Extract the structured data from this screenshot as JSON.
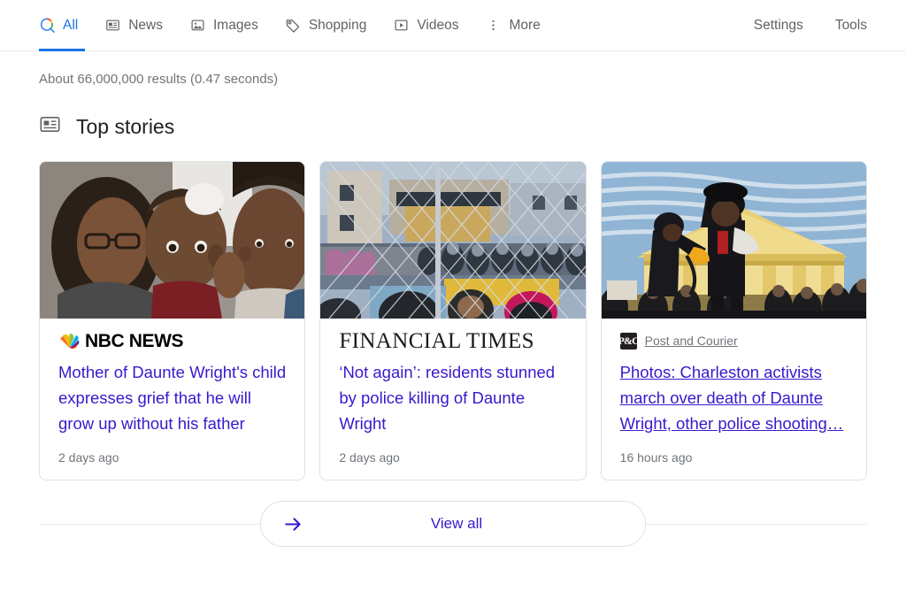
{
  "nav": {
    "tabs": [
      {
        "label": "All",
        "icon": "google-search-icon",
        "active": true
      },
      {
        "label": "News",
        "icon": "newspaper-icon",
        "active": false
      },
      {
        "label": "Images",
        "icon": "image-icon",
        "active": false
      },
      {
        "label": "Shopping",
        "icon": "price-tag-icon",
        "active": false
      },
      {
        "label": "Videos",
        "icon": "video-play-icon",
        "active": false
      },
      {
        "label": "More",
        "icon": "vertical-dots-icon",
        "active": false
      }
    ],
    "right_links": [
      {
        "label": "Settings"
      },
      {
        "label": "Tools"
      }
    ],
    "active_color": "#1a73e8",
    "inactive_color": "#5f6368"
  },
  "result_stats": "About 66,000,000 results (0.47 seconds)",
  "top_stories": {
    "heading": "Top stories",
    "heading_icon": "newspaper-icon",
    "cards": [
      {
        "source": "NBC NEWS",
        "source_logo": "nbc-news-logo",
        "headline": "Mother of Daunte Wright's child expresses grief that he will grow up without his father",
        "timestamp": "2 days ago",
        "hovered": false,
        "thumbnail": "photo-woman-holding-child-at-vigil"
      },
      {
        "source": "FINANCIAL TIMES",
        "source_logo": "financial-times-logo",
        "headline": "‘Not again’: residents stunned by police killing of Daunte Wright",
        "timestamp": "2 days ago",
        "hovered": false,
        "thumbnail": "photo-police-line-behind-chain-link-fence"
      },
      {
        "source": "Post and Courier",
        "source_logo": "post-and-courier-favicon",
        "headline": "Photos: Charleston activists march over death of Daunte Wright, other police shooting…",
        "timestamp": "16 hours ago",
        "hovered": true,
        "thumbnail": "photo-activists-with-megaphone-outside-customs-house"
      }
    ],
    "view_all": {
      "label": "View all",
      "icon": "arrow-right-icon",
      "color": "#3b18cc"
    }
  }
}
